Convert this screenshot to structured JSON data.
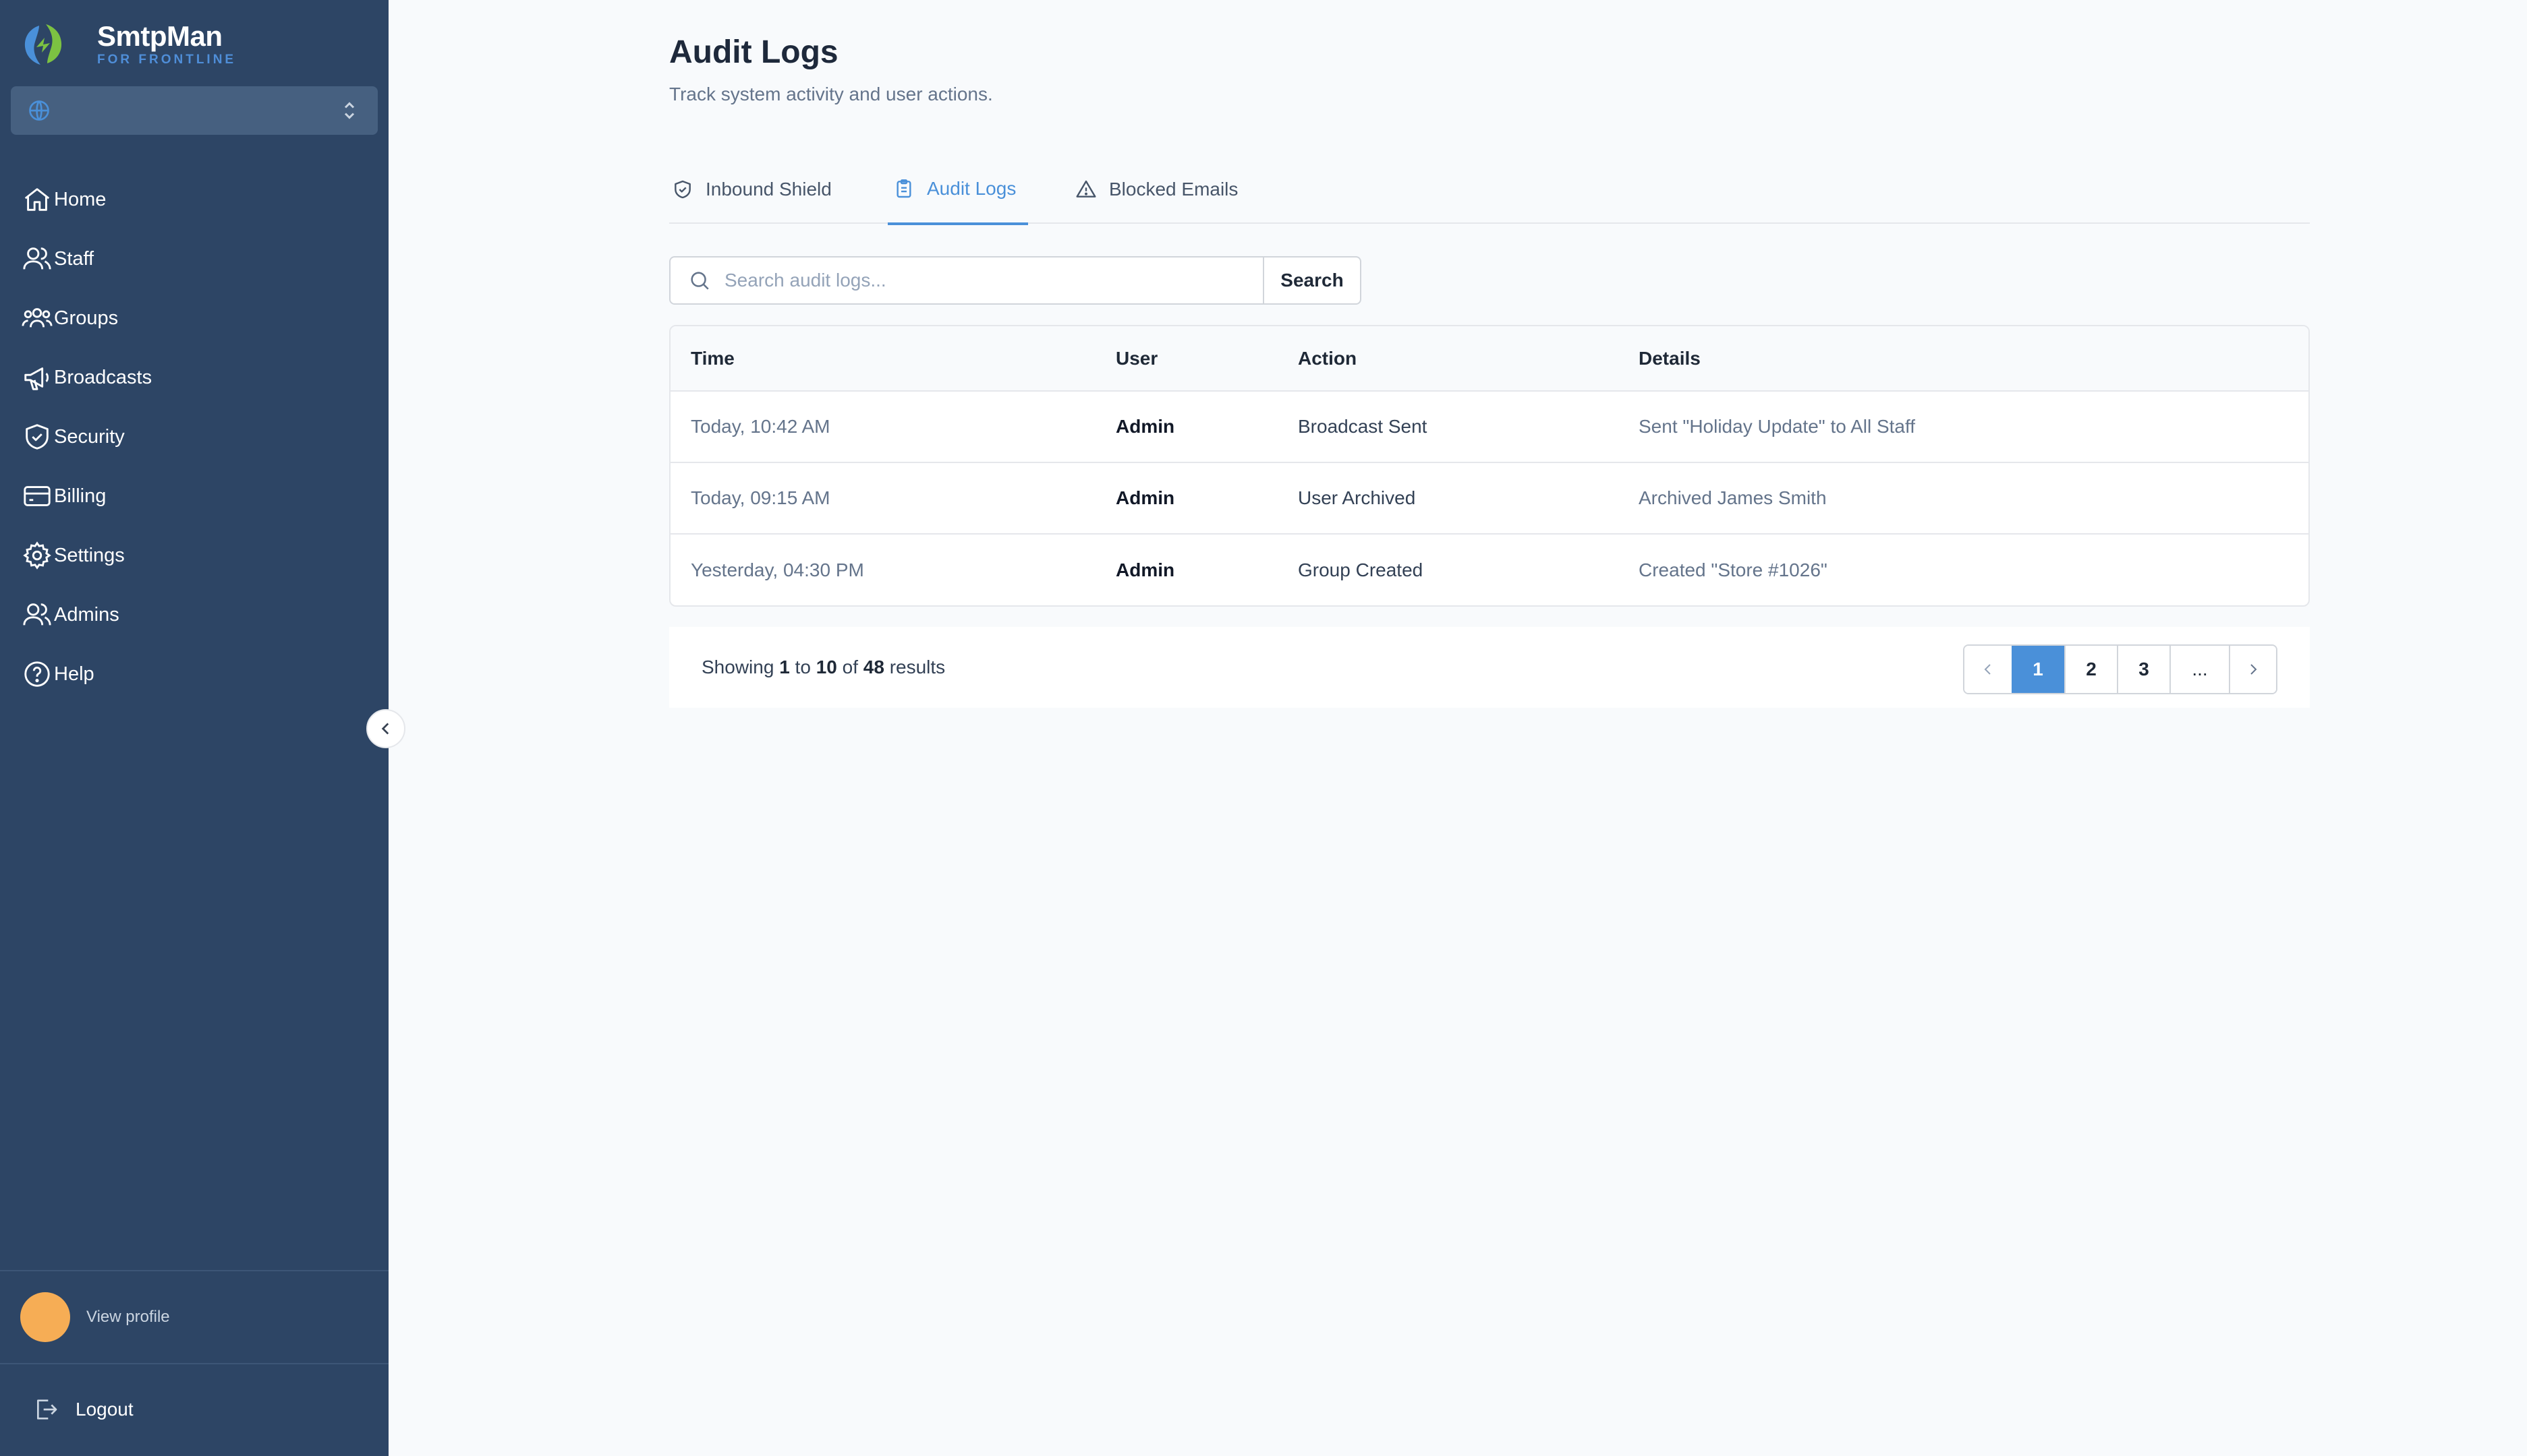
{
  "brand": {
    "name": "SmtpMan",
    "subtitle": "FOR FRONTLINE"
  },
  "sidebar": {
    "items": [
      {
        "label": "Home",
        "icon": "home-icon"
      },
      {
        "label": "Staff",
        "icon": "users-icon"
      },
      {
        "label": "Groups",
        "icon": "groups-icon"
      },
      {
        "label": "Broadcasts",
        "icon": "megaphone-icon"
      },
      {
        "label": "Security",
        "icon": "shield-check-icon"
      },
      {
        "label": "Billing",
        "icon": "credit-card-icon"
      },
      {
        "label": "Settings",
        "icon": "gear-icon"
      },
      {
        "label": "Admins",
        "icon": "users-icon"
      },
      {
        "label": "Help",
        "icon": "help-circle-icon"
      }
    ],
    "profile_label": "View profile",
    "logout_label": "Logout"
  },
  "page": {
    "title": "Audit Logs",
    "subtitle": "Track system activity and user actions."
  },
  "tabs": [
    {
      "label": "Inbound Shield",
      "icon": "shield-check-icon",
      "active": false
    },
    {
      "label": "Audit Logs",
      "icon": "clipboard-icon",
      "active": true
    },
    {
      "label": "Blocked Emails",
      "icon": "warning-triangle-icon",
      "active": false
    }
  ],
  "search": {
    "placeholder": "Search audit logs...",
    "value": "",
    "button_label": "Search"
  },
  "table": {
    "headers": {
      "time": "Time",
      "user": "User",
      "action": "Action",
      "details": "Details"
    },
    "rows": [
      {
        "time": "Today, 10:42 AM",
        "user": "Admin",
        "action": "Broadcast Sent",
        "details": "Sent \"Holiday Update\" to All Staff"
      },
      {
        "time": "Today, 09:15 AM",
        "user": "Admin",
        "action": "User Archived",
        "details": "Archived James Smith"
      },
      {
        "time": "Yesterday, 04:30 PM",
        "user": "Admin",
        "action": "Group Created",
        "details": "Created \"Store #1026\""
      }
    ]
  },
  "pagination": {
    "showing_prefix": "Showing",
    "from": "1",
    "to_word": "to",
    "to": "10",
    "of_word": "of",
    "total": "48",
    "results_word": "results",
    "pages": [
      "1",
      "2",
      "3"
    ],
    "ellipsis": "...",
    "current_page": "1"
  },
  "colors": {
    "sidebar_bg": "#2d4565",
    "accent": "#4a90d9",
    "avatar": "#f6ad55",
    "page_bg": "#f8fafc"
  }
}
